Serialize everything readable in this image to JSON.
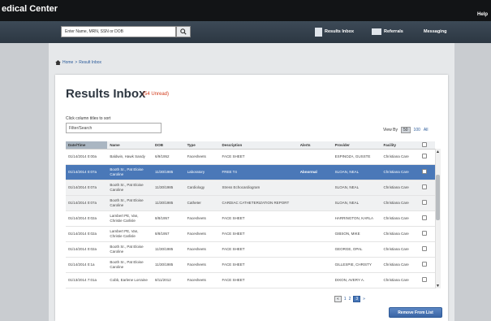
{
  "app": {
    "title": "edical Center",
    "help": "Help"
  },
  "nav": {
    "search_placeholder": "Enter Name, MRN, SSN or DOB",
    "results_inbox": "Results Inbox",
    "referrals": "Referrals",
    "messaging": "Messaging"
  },
  "breadcrumb": {
    "home": "Home",
    "sep": ">",
    "current": "Result Inbox"
  },
  "inbox": {
    "title": "Results Inbox",
    "unread": "(54 Unread)",
    "hint": "Click column titles to sort",
    "filter_placeholder": "Filter/Search",
    "view_by_label": "View By",
    "view_options": [
      "50",
      "100",
      "All"
    ]
  },
  "table": {
    "columns": [
      "Date/Time",
      "Name",
      "DOB",
      "Type",
      "Description",
      "Alerts",
      "Provider",
      "Facility"
    ],
    "rows": [
      {
        "date": "01/14/2014 0:00a",
        "name": "Baldwin, Hawk Sandy",
        "dob": "6/9/1952",
        "type": "Facesheets",
        "desc": "FACE SHEET",
        "alert": "",
        "provider": "ESPINOZA, GUSSTE",
        "facility": "Christiana Care",
        "state": "normal"
      },
      {
        "date": "01/14/2014 0:07a",
        "name": "Booth Sr., Pat Eloise Caroline",
        "dob": "11/30/1985",
        "type": "Laboratory",
        "desc": "FREE T4",
        "alert": "Abnormal",
        "provider": "SLOAN, NEAL",
        "facility": "Christiana Care",
        "state": "selected"
      },
      {
        "date": "01/14/2014 0:07a",
        "name": "Booth Sr., Pat Eloise Caroline",
        "dob": "11/30/1985",
        "type": "Cardiology",
        "desc": "Stress Echocardiogram",
        "alert": "",
        "provider": "SLOAN, NEAL",
        "facility": "Christiana Care",
        "state": "gray"
      },
      {
        "date": "01/14/2014 0:07a",
        "name": "Booth Sr., Pat Eloise Caroline",
        "dob": "11/30/1985",
        "type": "Catheter",
        "desc": "CARDIAC CATHETERIZATION REPORT",
        "alert": "",
        "provider": "SLOAN, NEAL",
        "facility": "Christiana Care",
        "state": "gray"
      },
      {
        "date": "01/14/2014 0:02a",
        "name": "Lambert PE, Van, Christie Carlisle",
        "dob": "8/8/1957",
        "type": "Facesheets",
        "desc": "FACE SHEET",
        "alert": "",
        "provider": "HARRINGTON, KARLA",
        "facility": "Christiana Care",
        "state": "normal"
      },
      {
        "date": "01/14/2014 0:02a",
        "name": "Lambert PE, Van, Christie Carlisle",
        "dob": "8/8/1957",
        "type": "Facesheets",
        "desc": "FACE SHEET",
        "alert": "",
        "provider": "GIBSON, MIKE",
        "facility": "Christiana Care",
        "state": "normal"
      },
      {
        "date": "01/14/2014 0:02a",
        "name": "Booth Sr., Pat Eloise Caroline",
        "dob": "11/30/1985",
        "type": "Facesheets",
        "desc": "FACE SHEET",
        "alert": "",
        "provider": "GEORGE, OPAL",
        "facility": "Christiana Care",
        "state": "normal"
      },
      {
        "date": "01/14/2014 0:1a",
        "name": "Booth Sr., Pat Eloise Caroline",
        "dob": "11/30/1985",
        "type": "Facesheets",
        "desc": "FACE SHEET",
        "alert": "",
        "provider": "GILLESPIE, CHRISTY",
        "facility": "Christiana Care",
        "state": "normal"
      },
      {
        "date": "01/13/2014 7:01a",
        "name": "Cobb, Earlene Lorraine",
        "dob": "8/11/2012",
        "type": "Facesheets",
        "desc": "FACE SHEET",
        "alert": "",
        "provider": "DIXON, AVERY A.",
        "facility": "Christiana Care",
        "state": "normal"
      }
    ]
  },
  "pager": {
    "prev": "«",
    "pages": [
      "1",
      "2",
      "3"
    ],
    "current": "3",
    "next": "»"
  },
  "actions": {
    "remove": "Remove From List"
  }
}
